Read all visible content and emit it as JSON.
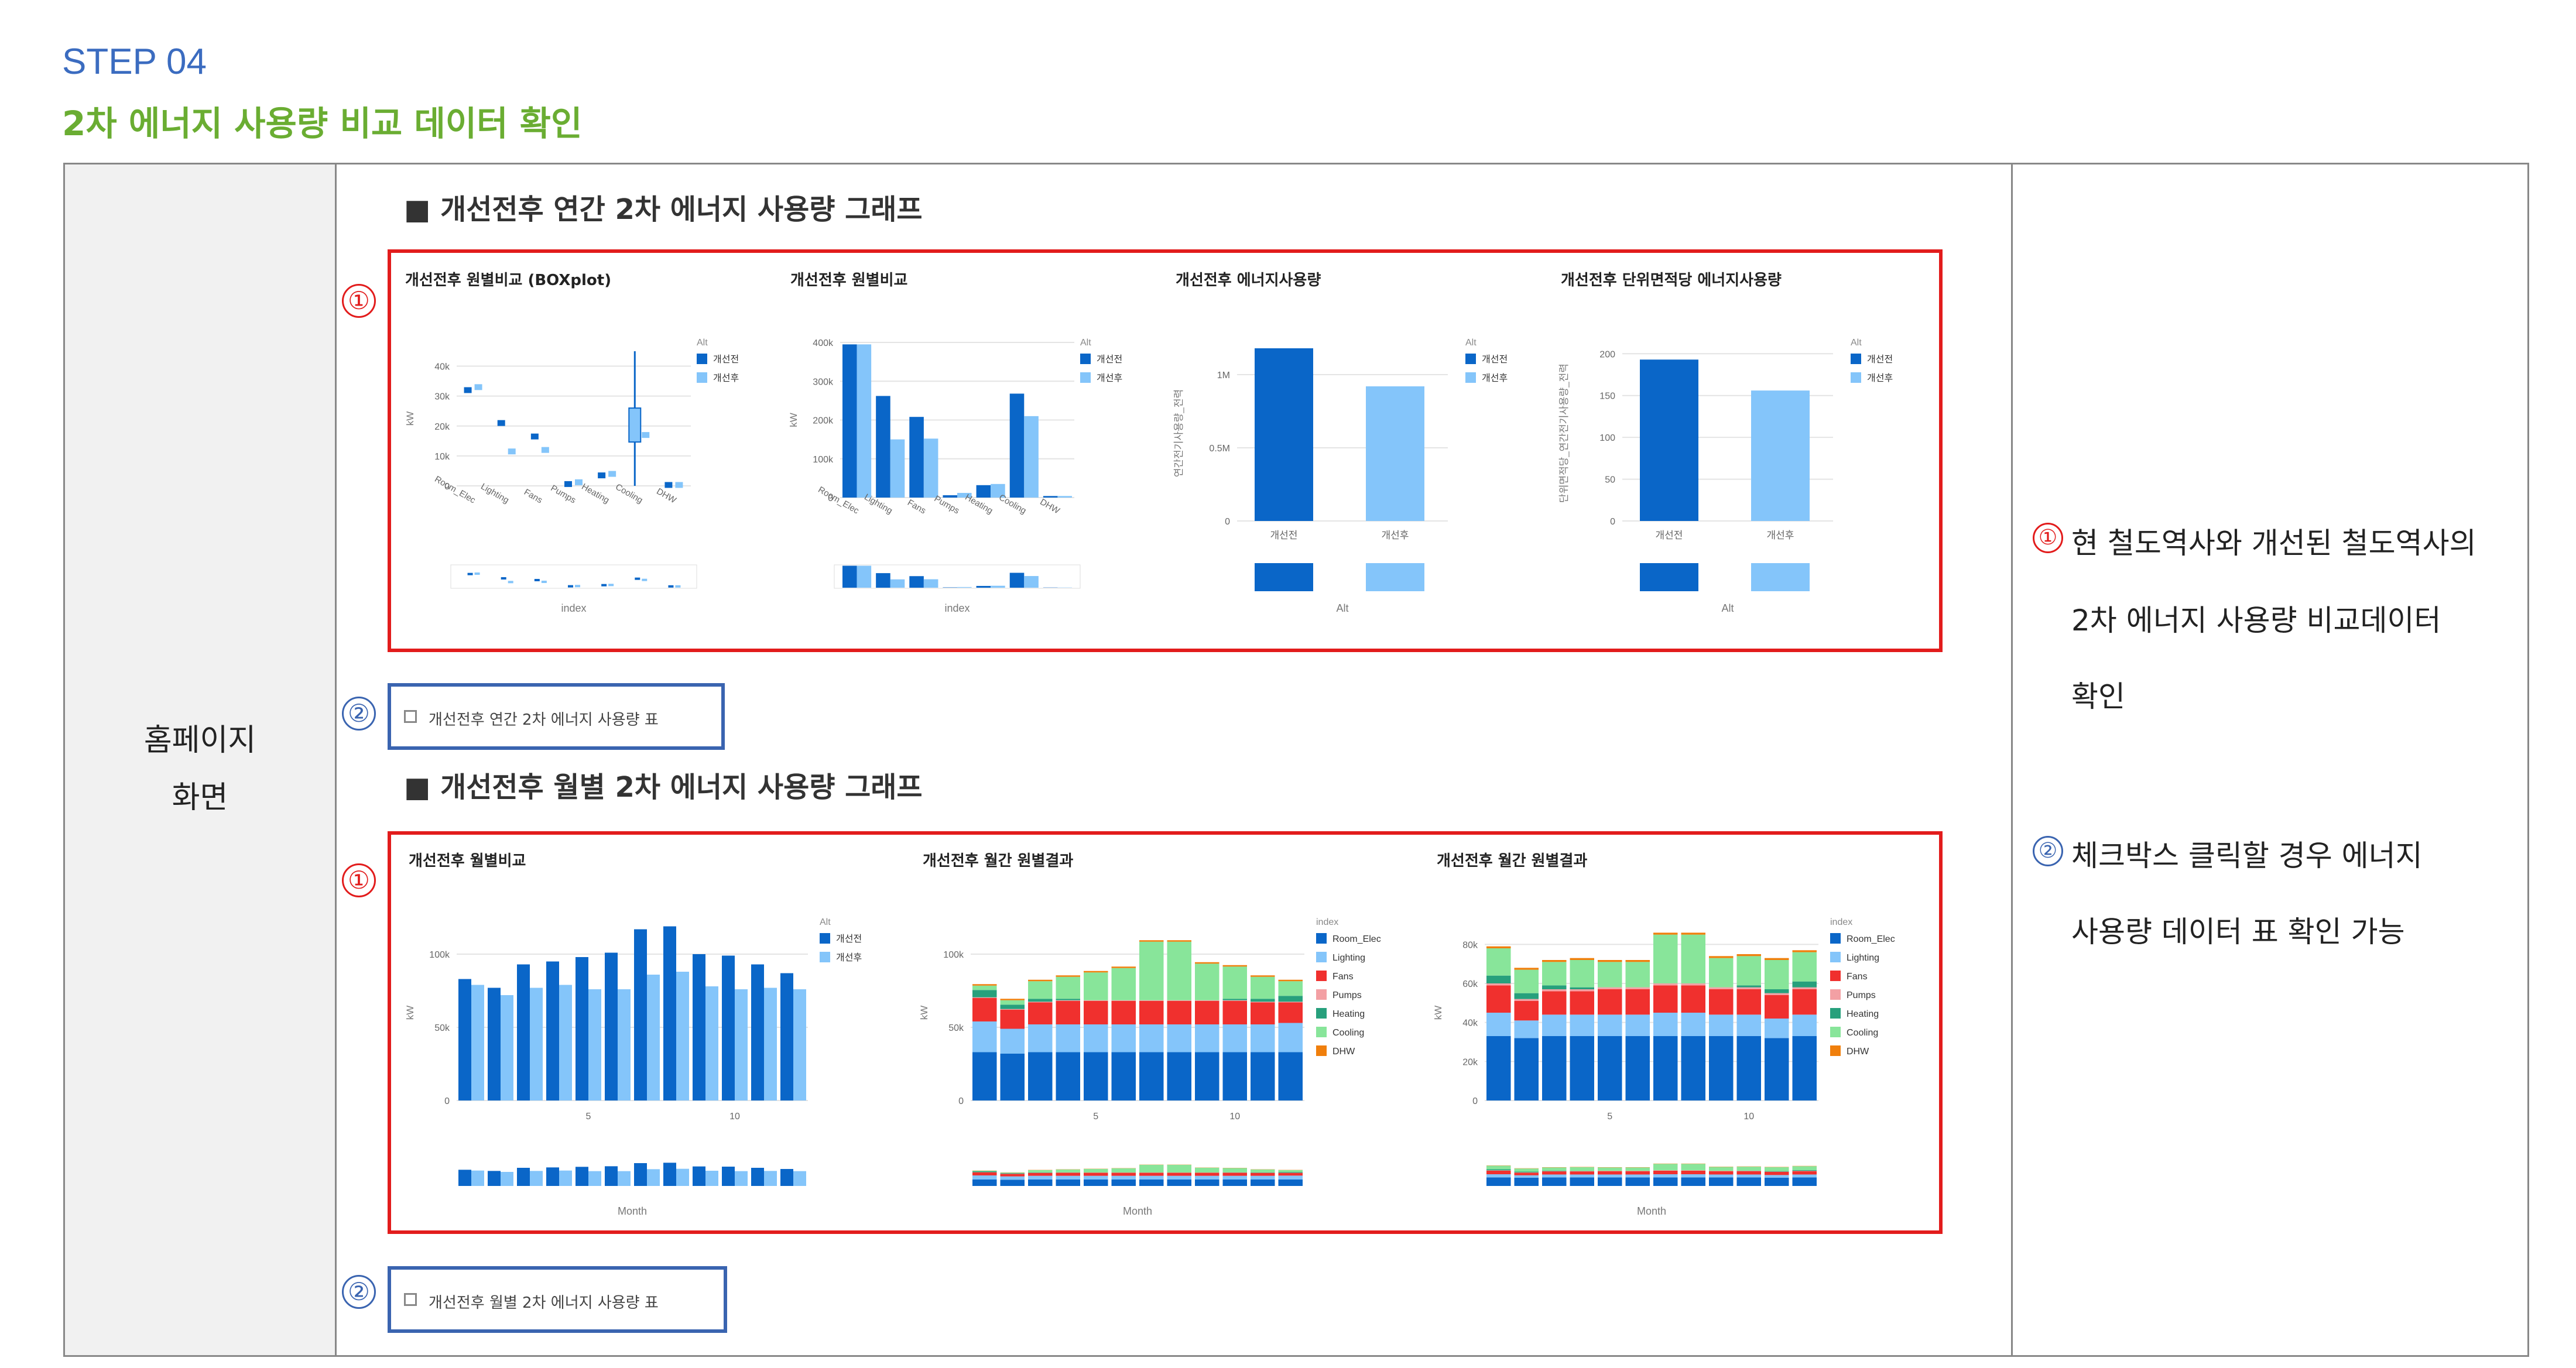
{
  "step": {
    "label": "STEP 04",
    "title": "2차 에너지 사용량 비교 데이터 확인"
  },
  "left": {
    "line1": "홈페이지",
    "line2": "화면"
  },
  "section1": {
    "heading": "■ 개선전후 연간 2차 에너지 사용량 그래프",
    "checkbox_label": "개선전후 연간 2차 에너지 사용량 표"
  },
  "section2": {
    "heading": "■ 개선전후 월별 2차 에너지 사용량 그래프",
    "checkbox_label": "개선전후 월별 2차 에너지 사용량 표"
  },
  "markers": {
    "one": "①",
    "two": "②"
  },
  "right": {
    "item1": {
      "line1": "현 철도역사와 개선된 철도역사의",
      "line2": "2차 에너지 사용량 비교데이터",
      "line3": "확인"
    },
    "item2": {
      "line1": "체크박스 클릭할 경우 에너지",
      "line2": "사용량 데이터 표 확인 가능"
    }
  },
  "colors": {
    "before": "#0a66c8",
    "after": "#84c5fa",
    "Room_Elec": "#0a66c8",
    "Lighting": "#84c5fa",
    "Fans": "#f0302e",
    "Pumps": "#f3a0a4",
    "Heating": "#27a07c",
    "Cooling": "#88e59a",
    "DHW": "#f07f0c"
  },
  "chart_data": [
    {
      "type": "box",
      "title": "개선전후 원별비교 (BOXplot)",
      "ylabel": "kW",
      "xlabel": "index",
      "legend_title": "Alt",
      "series_names": [
        "개선전",
        "개선후"
      ],
      "categories": [
        "Room_Elec",
        "Lighting",
        "Fans",
        "Pumps",
        "Heating",
        "Cooling",
        "DHW"
      ],
      "yticks": [
        "0",
        "10k",
        "20k",
        "30k",
        "40k"
      ],
      "ylim": [
        0,
        45000
      ],
      "before_median": [
        32000,
        21000,
        16500,
        600,
        3500,
        20000,
        300
      ],
      "after_median": [
        33000,
        11500,
        12000,
        1200,
        4000,
        17000,
        300
      ]
    },
    {
      "type": "bar",
      "title": "개선전후 원별비교",
      "ylabel": "kW",
      "xlabel": "index",
      "legend_title": "Alt",
      "series_names": [
        "개선전",
        "개선후"
      ],
      "categories": [
        "Room_Elec",
        "Lighting",
        "Fans",
        "Pumps",
        "Heating",
        "Cooling",
        "DHW"
      ],
      "yticks": [
        "0",
        "100k",
        "200k",
        "300k",
        "400k"
      ],
      "ylim": [
        0,
        400000
      ],
      "before": [
        395000,
        262000,
        208000,
        6000,
        32000,
        268000,
        4000
      ],
      "after": [
        395000,
        150000,
        152000,
        12000,
        35000,
        210000,
        4000
      ]
    },
    {
      "type": "bar",
      "title": "개선전후 에너지사용량",
      "ylabel": "연간전기사용량_전력",
      "xlabel": "Alt",
      "legend_title": "Alt",
      "series_names": [
        "개선전",
        "개선후"
      ],
      "categories": [
        "개선전",
        "개선후"
      ],
      "yticks": [
        "0",
        "0.5M",
        "1M"
      ],
      "ylim": [
        0,
        1200000
      ],
      "values": [
        1180000,
        920000
      ]
    },
    {
      "type": "bar",
      "title": "개선전후 단위면적당 에너지사용량",
      "ylabel": "단위면적당_연간전기사용량_전력",
      "xlabel": "Alt",
      "legend_title": "Alt",
      "series_names": [
        "개선전",
        "개선후"
      ],
      "categories": [
        "개선전",
        "개선후"
      ],
      "yticks": [
        "0",
        "50",
        "100",
        "150",
        "200"
      ],
      "ylim": [
        0,
        210
      ],
      "values": [
        193,
        156
      ]
    },
    {
      "type": "bar",
      "title": "개선전후 월별비교",
      "ylabel": "kW",
      "xlabel": "Month",
      "legend_title": "Alt",
      "series_names": [
        "개선전",
        "개선후"
      ],
      "x": [
        1,
        2,
        3,
        4,
        5,
        6,
        7,
        8,
        9,
        10,
        11,
        12
      ],
      "xticks": [
        "5",
        "10"
      ],
      "yticks": [
        "0",
        "50k",
        "100k"
      ],
      "ylim": [
        0,
        120000
      ],
      "before": [
        83000,
        77000,
        93000,
        95000,
        98000,
        101000,
        117000,
        119000,
        100000,
        99000,
        93000,
        87000
      ],
      "after": [
        79000,
        72000,
        77000,
        79000,
        76000,
        76000,
        86000,
        88000,
        78000,
        76000,
        77000,
        76000
      ]
    },
    {
      "type": "bar",
      "stacked": true,
      "title": "개선전후 월간 원별결과",
      "ylabel": "kW",
      "xlabel": "Month",
      "legend_title": "index",
      "series_names": [
        "Room_Elec",
        "Lighting",
        "Fans",
        "Pumps",
        "Heating",
        "Cooling",
        "DHW"
      ],
      "x": [
        1,
        2,
        3,
        4,
        5,
        6,
        7,
        8,
        9,
        10,
        11,
        12
      ],
      "xticks": [
        "5",
        "10"
      ],
      "yticks": [
        "0",
        "50k",
        "100k"
      ],
      "ylim": [
        0,
        120000
      ],
      "series": [
        {
          "name": "Room_Elec",
          "values": [
            33000,
            32000,
            33000,
            33000,
            33000,
            33000,
            33000,
            33000,
            33000,
            33000,
            33000,
            33000
          ]
        },
        {
          "name": "Lighting",
          "values": [
            21000,
            17000,
            19000,
            19000,
            19000,
            19000,
            19000,
            19000,
            19000,
            19000,
            19000,
            20000
          ]
        },
        {
          "name": "Fans",
          "values": [
            16000,
            13000,
            15000,
            16000,
            16000,
            16000,
            16000,
            16000,
            16000,
            16000,
            15000,
            14000
          ]
        },
        {
          "name": "Pumps",
          "values": [
            500,
            500,
            500,
            500,
            500,
            500,
            500,
            500,
            500,
            500,
            500,
            500
          ]
        },
        {
          "name": "Heating",
          "values": [
            5000,
            3000,
            2000,
            1000,
            0,
            0,
            0,
            0,
            0,
            1000,
            2000,
            4000
          ]
        },
        {
          "name": "Cooling",
          "values": [
            3000,
            3000,
            12000,
            15000,
            19000,
            22000,
            40000,
            40000,
            25000,
            22000,
            15000,
            10000
          ]
        },
        {
          "name": "DHW",
          "values": [
            1000,
            1000,
            1000,
            1000,
            1000,
            1000,
            1000,
            1000,
            1000,
            1000,
            1000,
            1000
          ]
        }
      ]
    },
    {
      "type": "bar",
      "stacked": true,
      "title": "개선전후 월간 원별결과",
      "ylabel": "kW",
      "xlabel": "Month",
      "legend_title": "index",
      "series_names": [
        "Room_Elec",
        "Lighting",
        "Fans",
        "Pumps",
        "Heating",
        "Cooling",
        "DHW"
      ],
      "x": [
        1,
        2,
        3,
        4,
        5,
        6,
        7,
        8,
        9,
        10,
        11,
        12
      ],
      "xticks": [
        "5",
        "10"
      ],
      "yticks": [
        "0",
        "20k",
        "40k",
        "60k",
        "80k"
      ],
      "ylim": [
        0,
        90000
      ],
      "series": [
        {
          "name": "Room_Elec",
          "values": [
            33000,
            32000,
            33000,
            33000,
            33000,
            33000,
            33000,
            33000,
            33000,
            33000,
            32000,
            33000
          ]
        },
        {
          "name": "Lighting",
          "values": [
            12000,
            9000,
            11000,
            11000,
            11000,
            11000,
            12000,
            12000,
            11000,
            11000,
            10000,
            11000
          ]
        },
        {
          "name": "Fans",
          "values": [
            14000,
            10000,
            12000,
            12000,
            13000,
            13000,
            14000,
            14000,
            13000,
            13000,
            12000,
            13000
          ]
        },
        {
          "name": "Pumps",
          "values": [
            1000,
            1000,
            1000,
            1000,
            1000,
            1000,
            1000,
            1000,
            1000,
            1000,
            1000,
            1000
          ]
        },
        {
          "name": "Heating",
          "values": [
            4000,
            3000,
            2000,
            1000,
            0,
            0,
            0,
            0,
            0,
            1000,
            2000,
            3000
          ]
        },
        {
          "name": "Cooling",
          "values": [
            14000,
            12000,
            12000,
            14000,
            13000,
            13000,
            25000,
            25000,
            15000,
            15000,
            15000,
            15000
          ]
        },
        {
          "name": "DHW",
          "values": [
            1000,
            1000,
            1000,
            1000,
            1000,
            1000,
            1000,
            1000,
            1000,
            1000,
            1000,
            1000
          ]
        }
      ]
    }
  ]
}
